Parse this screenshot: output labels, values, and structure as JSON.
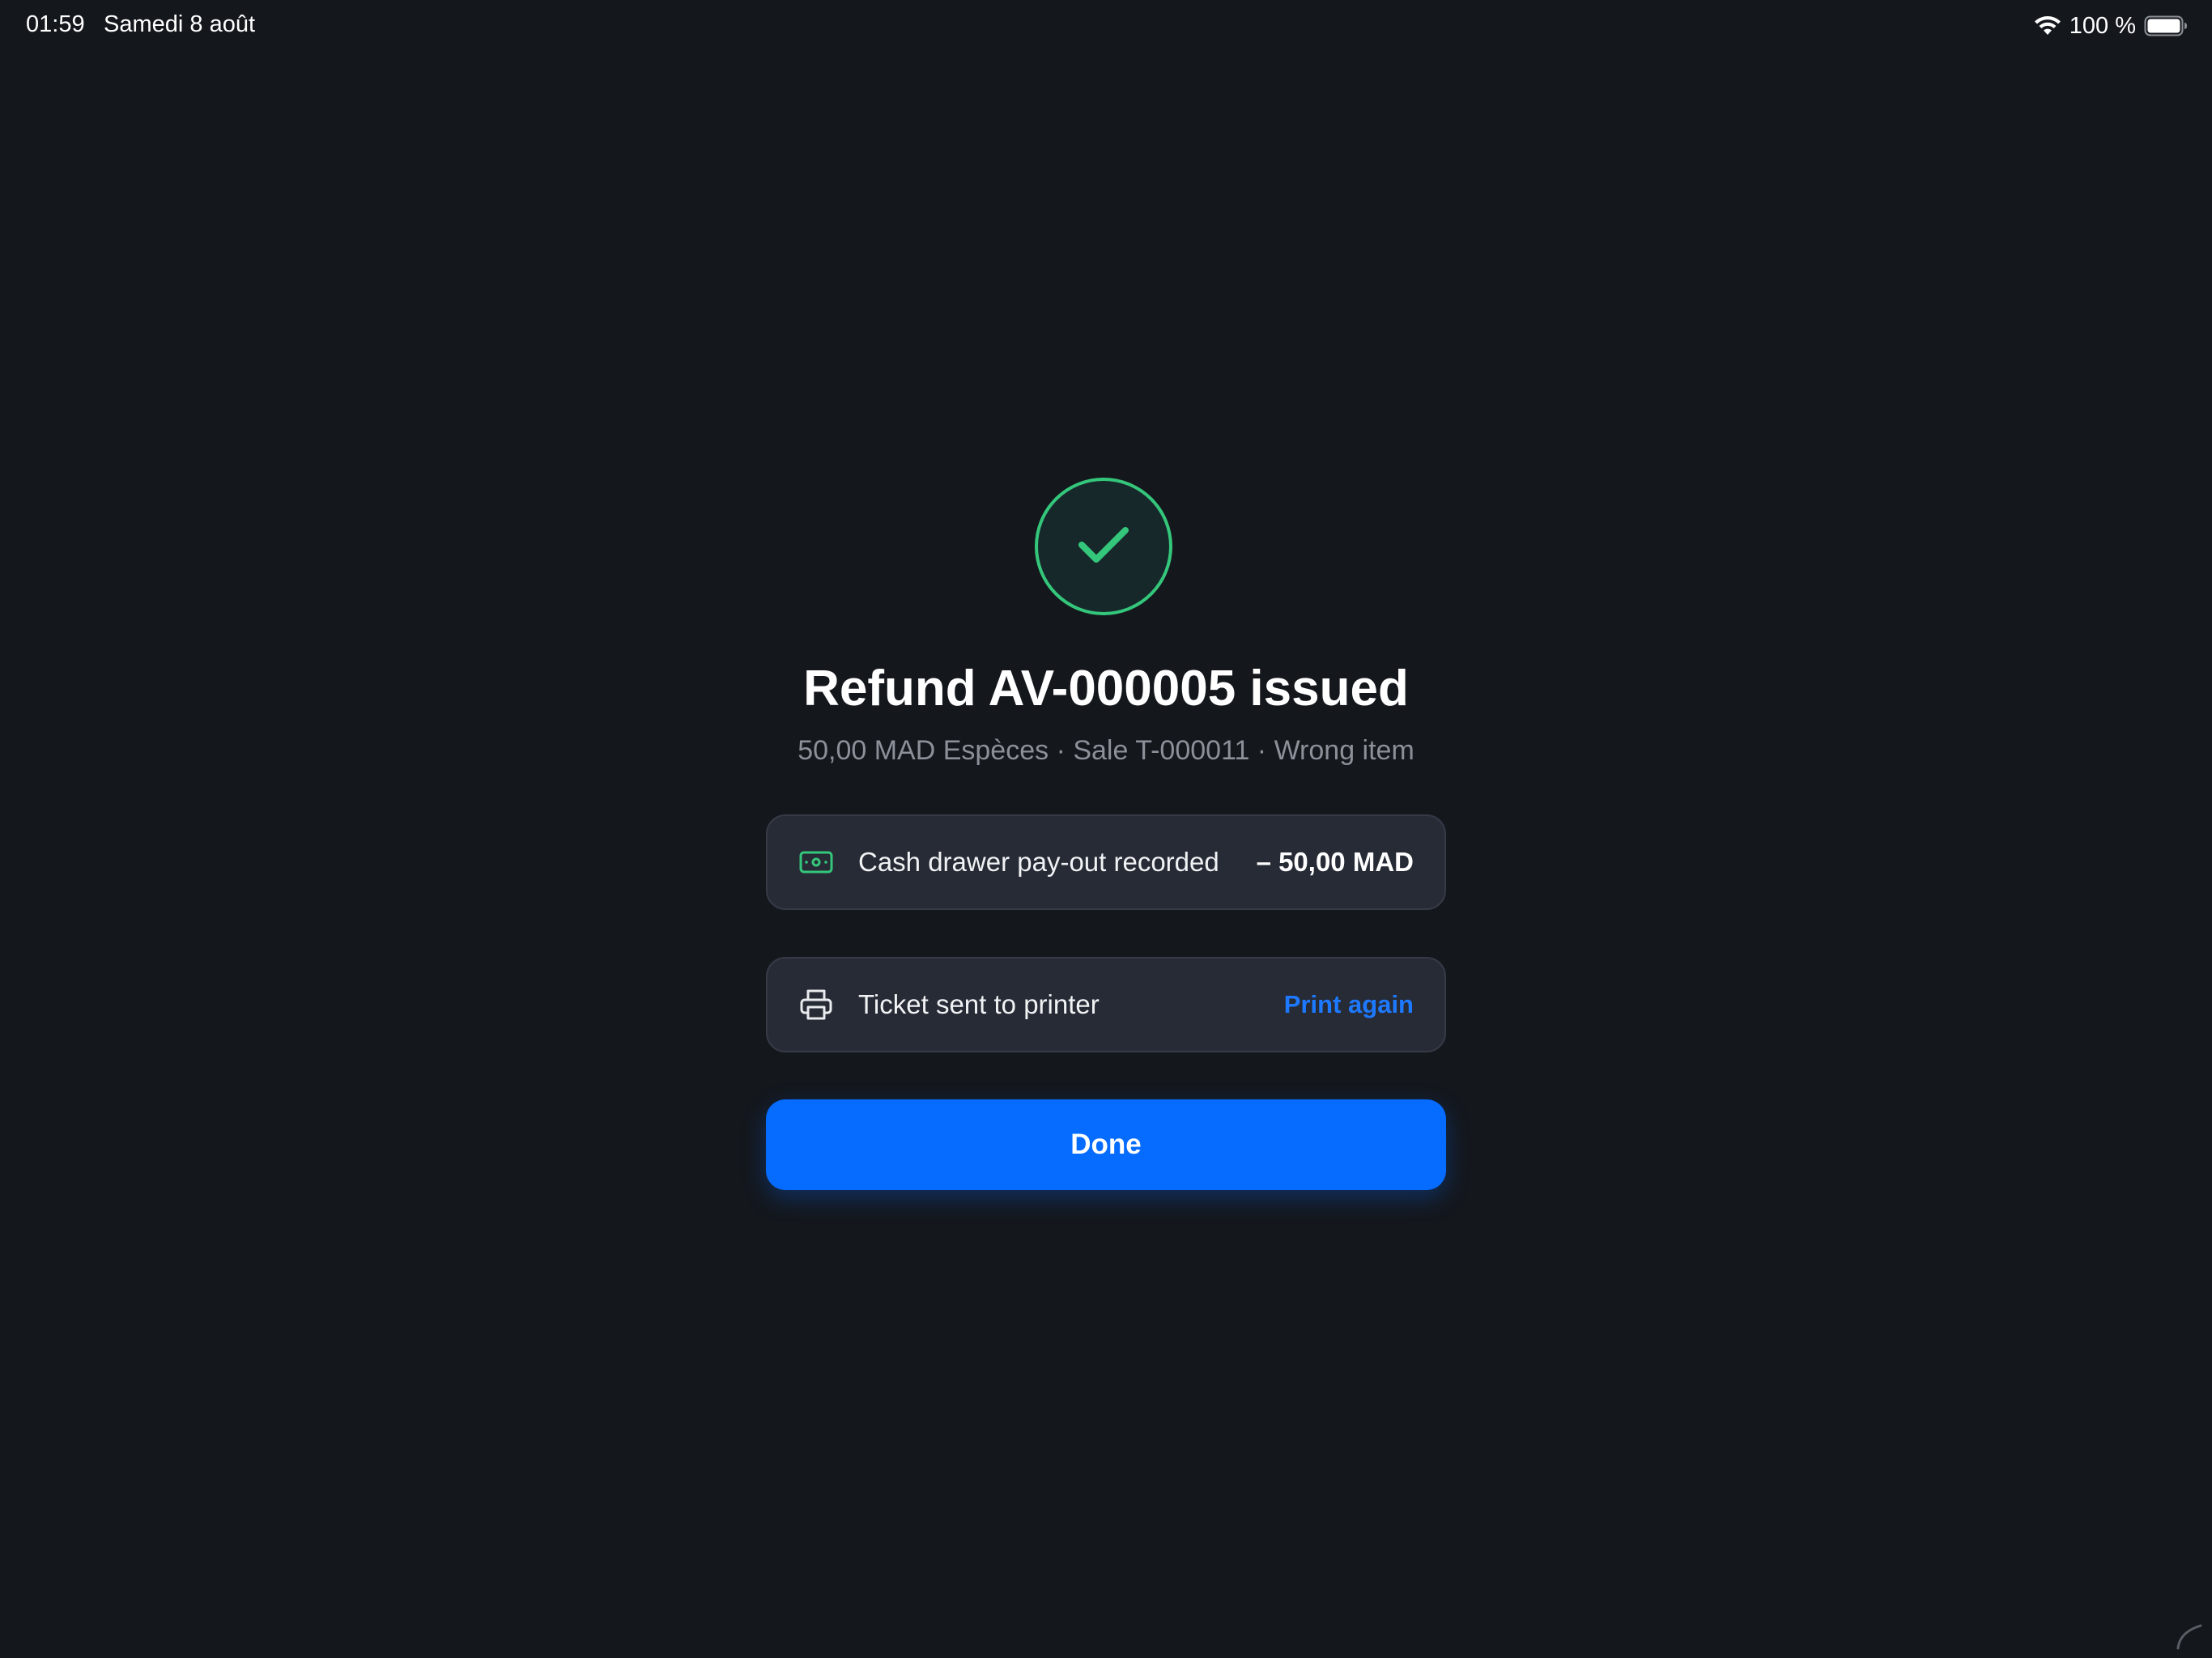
{
  "status_bar": {
    "time": "01:59",
    "date": "Samedi 8 août",
    "battery_percent": "100 %",
    "wifi_icon": "wifi-icon",
    "battery_icon": "battery-icon"
  },
  "result": {
    "icon": "checkmark-icon",
    "title": "Refund AV-000005 issued",
    "subtitle": "50,00 MAD Espèces · Sale T-000011 · Wrong item"
  },
  "cards": {
    "cash": {
      "icon": "banknote-icon",
      "label": "Cash drawer pay-out recorded",
      "amount": "– 50,00 MAD"
    },
    "printer": {
      "icon": "printer-icon",
      "label": "Ticket sent to printer",
      "action_label": "Print again"
    }
  },
  "done_button_label": "Done",
  "colors": {
    "background": "#14171c",
    "card": "#272b36",
    "accent_blue": "#066bff",
    "link_blue": "#1d79ff",
    "success_green": "#34c77b",
    "muted_text": "#8b9099"
  }
}
